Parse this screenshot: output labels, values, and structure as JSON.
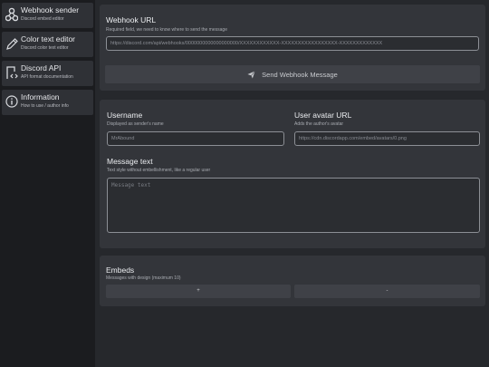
{
  "sidebar": {
    "items": [
      {
        "title": "Webhook sender",
        "subtitle": "Discord embed editor",
        "icon": "webhook-icon"
      },
      {
        "title": "Color text editor",
        "subtitle": "Discord color text editor",
        "icon": "pencil-icon"
      },
      {
        "title": "Discord API",
        "subtitle": "API format documentation",
        "icon": "api-doc-icon"
      },
      {
        "title": "Information",
        "subtitle": "How to use / author info",
        "icon": "info-icon"
      }
    ]
  },
  "webhook": {
    "label": "Webhook URL",
    "hint": "Required field, we need to know where to send the message",
    "url_value": "https://discord.com/api/webhooks/0000000000000000000/XXXXXXXXXXXX-XXXXXXXXXXXXXXXXX-XXXXXXXXXXXXX",
    "send_label": "Send Webhook Message",
    "send_icon": "paper-plane-icon"
  },
  "profile": {
    "username_label": "Username",
    "username_hint": "Displayed as sender's name",
    "username_placeholder": "MrAbound",
    "avatar_label": "User avatar URL",
    "avatar_hint": "Adds the author's avatar",
    "avatar_placeholder": "https://cdn.discordapp.com/embed/avatars/0.png",
    "message_label": "Message text",
    "message_hint": "Text style without embellishment, like a regular user",
    "message_placeholder": "Message text"
  },
  "embeds": {
    "label": "Embeds",
    "hint": "Messages with design (maximum 10)",
    "add_label": "+",
    "remove_label": "-"
  },
  "colors": {
    "sidebar_bg": "#1b1c1f",
    "panel_bg": "#33353a",
    "button_bg": "#3f4147"
  }
}
